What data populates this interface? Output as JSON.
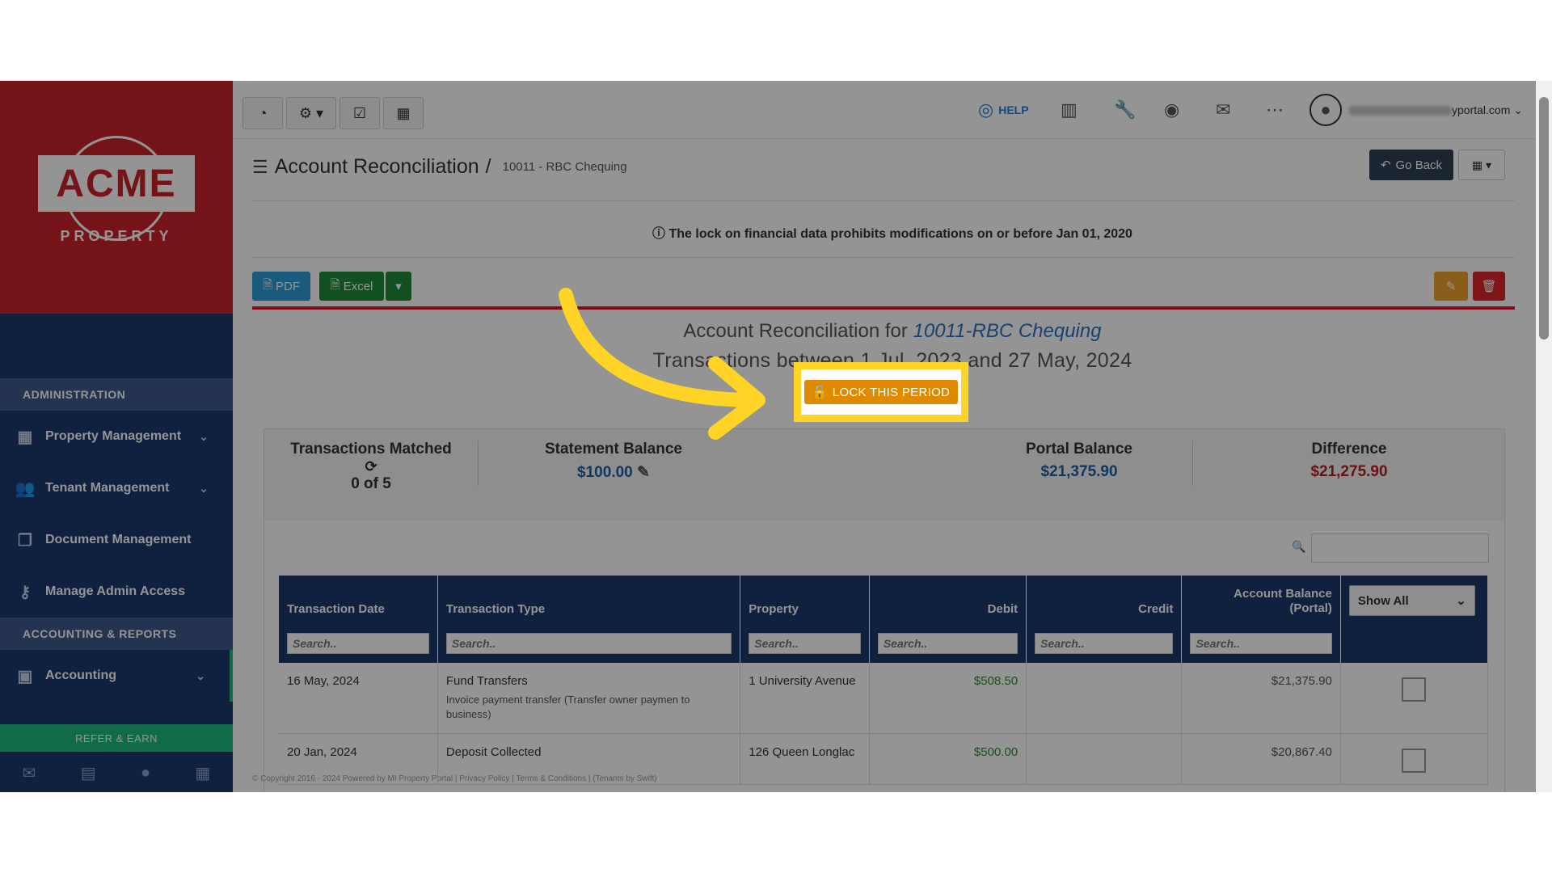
{
  "sidebar": {
    "logo": {
      "main": "ACME",
      "sub": "PROPERTY"
    },
    "admin_header": "ADMINISTRATION",
    "admin_items": [
      {
        "label": "Property Management",
        "icon": "building-icon"
      },
      {
        "label": "Tenant Management",
        "icon": "users-icon"
      },
      {
        "label": "Document Management",
        "icon": "documents-icon"
      },
      {
        "label": "Manage Admin Access",
        "icon": "key-icon"
      }
    ],
    "accounting_header": "ACCOUNTING & REPORTS",
    "accounting_item": {
      "label": "Accounting",
      "icon": "money-icon"
    },
    "refer_label": "REFER & EARN",
    "bottom_icons": [
      "mail-icon",
      "briefcase-icon",
      "user-icon",
      "calculator-icon"
    ]
  },
  "topbar": {
    "help_label": "HELP",
    "user_email_suffix": "yportal.com"
  },
  "header": {
    "title": "Account Reconciliation",
    "separator": "/",
    "account": "10011 - RBC Chequing",
    "go_back": "Go Back"
  },
  "lock_notice": "The lock on financial data prohibits modifications on or before Jan 01, 2020",
  "export": {
    "pdf": "PDF",
    "excel": "Excel"
  },
  "report": {
    "title_prefix": "Account Reconciliation for",
    "title_account": "10011-RBC Chequing",
    "subtitle": "Transactions between 1 Jul, 2023 and 27 May, 2024",
    "lock_button": "LOCK THIS PERIOD"
  },
  "summary": {
    "matched_label": "Transactions Matched",
    "matched_value": "0 of 5",
    "statement_label": "Statement Balance",
    "statement_value": "$100.00",
    "portal_label": "Portal Balance",
    "portal_value": "$21,375.90",
    "difference_label": "Difference",
    "difference_value": "$21,275.90"
  },
  "table": {
    "columns": [
      "Transaction Date",
      "Transaction Type",
      "Property",
      "Debit",
      "Credit",
      "Account Balance (Portal)"
    ],
    "search_placeholder": "Search..",
    "show_all": "Show All",
    "rows": [
      {
        "date": "16 May, 2024",
        "type": "Fund Transfers",
        "note": "Invoice payment transfer (Transfer owner paymen to business)",
        "property": "1 University Avenue",
        "debit": "$508.50",
        "credit": "",
        "balance": "$21,375.90"
      },
      {
        "date": "20 Jan, 2024",
        "type": "Deposit Collected",
        "note": "",
        "property": "126 Queen Longlac",
        "debit": "$500.00",
        "credit": "",
        "balance": "$20,867.40"
      }
    ]
  },
  "footer": "© Copyright 2016 - 2024 Powered by MI Property Portal | Privacy Policy | Terms & Conditions | (Tenants by Swift)",
  "colors": {
    "brand_red": "#c8232c",
    "navy": "#1d3a6e",
    "highlight": "#ffd426",
    "lock_orange": "#e08a00"
  }
}
